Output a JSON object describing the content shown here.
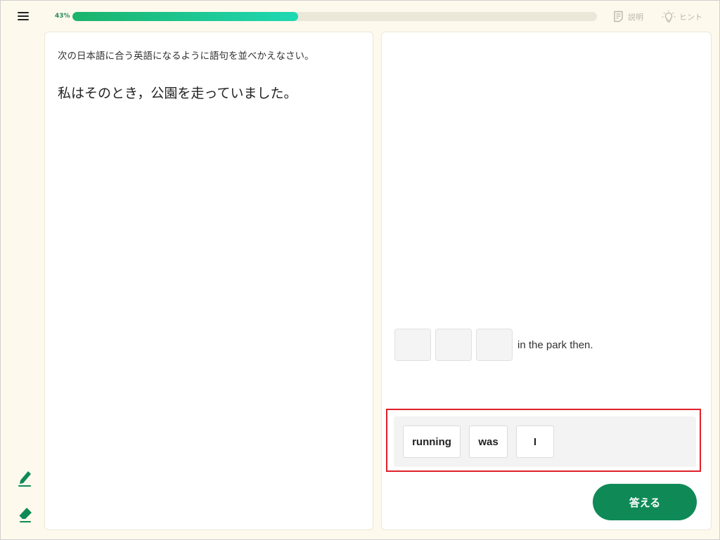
{
  "header": {
    "progress_label": "43%",
    "progress_fraction": 0.43,
    "explain_label": "説明",
    "hint_label": "ヒント"
  },
  "left_panel": {
    "instruction": "次の日本語に合う英語になるように語句を並べかえなさい。",
    "question": "私はそのとき，公園を走っていました。"
  },
  "right_panel": {
    "answer_slots": 3,
    "sentence_suffix": "in the park then.",
    "word_bank": [
      "running",
      "was",
      "I"
    ],
    "submit_label": "答える"
  },
  "side_tools": [
    "pencil-icon",
    "eraser-icon"
  ],
  "colors": {
    "accent": "#0f8a57",
    "progress_start": "#1bb36b",
    "progress_end": "#1fd8b3",
    "highlight_border": "#e0202a",
    "background": "#fdf9ec"
  }
}
